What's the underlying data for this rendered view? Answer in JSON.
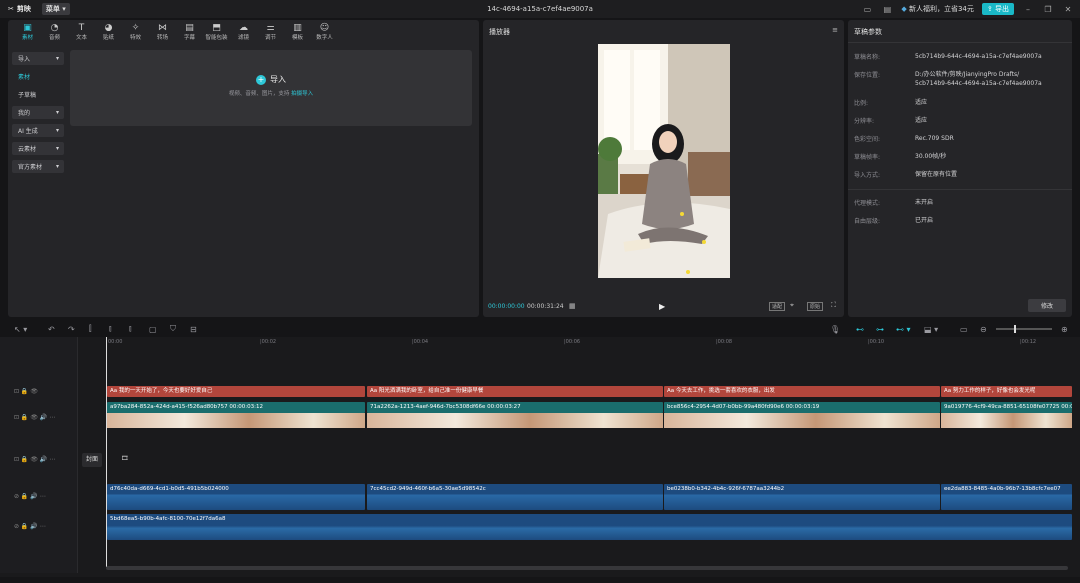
{
  "titlebar": {
    "app_name": "剪映",
    "menu_label": "菜单",
    "project_title": "14c-4694-a15a-c7ef4ae9007a",
    "promo": "新人福利，立省34元",
    "export_label": "导出"
  },
  "tabs": [
    {
      "label": "素材",
      "icon": "media-icon",
      "active": true
    },
    {
      "label": "音频",
      "icon": "audio-icon"
    },
    {
      "label": "文本",
      "icon": "text-icon"
    },
    {
      "label": "贴纸",
      "icon": "sticker-icon"
    },
    {
      "label": "特效",
      "icon": "effects-icon"
    },
    {
      "label": "转场",
      "icon": "transition-icon"
    },
    {
      "label": "字幕",
      "icon": "caption-icon"
    },
    {
      "label": "智能包装",
      "icon": "smart-pack-icon"
    },
    {
      "label": "滤镜",
      "icon": "filter-icon"
    },
    {
      "label": "调节",
      "icon": "adjust-icon"
    },
    {
      "label": "模板",
      "icon": "template-icon"
    },
    {
      "label": "数字人",
      "icon": "avatar-icon"
    }
  ],
  "sidebar": {
    "items": [
      {
        "label": "导入",
        "chevron": true,
        "box": true
      },
      {
        "label": "素材",
        "highlight": true
      },
      {
        "label": "子草稿"
      },
      {
        "label": "我的",
        "chevron": true,
        "box": true
      },
      {
        "label": "AI 生成",
        "chevron": true,
        "box": true
      },
      {
        "label": "云素材",
        "chevron": true,
        "box": true
      },
      {
        "label": "官方素材",
        "chevron": true,
        "box": true
      }
    ]
  },
  "import_area": {
    "button_label": "导入",
    "hint": "视频、音频、图片，支持",
    "hint_link": "拍摄导入"
  },
  "player": {
    "title": "播放器",
    "current_time": "00:00:00:00",
    "total_time": "00:00:31:24",
    "ratio_btn": "适配",
    "original_btn": "原始"
  },
  "params": {
    "title": "草稿参数",
    "rows": [
      {
        "key": "草稿名称:",
        "value": "5cb714b9-644c-4694-a15a-c7ef4ae9007a"
      },
      {
        "key": "保存位置:",
        "value": "D:/办公软件/剪映/JianyingPro Drafts/",
        "value2": "5cb714b9-644c-4694-a15a-c7ef4ae9007a"
      },
      {
        "key": "比例:",
        "value": "适应"
      },
      {
        "key": "分辨率:",
        "value": "适应"
      },
      {
        "key": "色彩空间:",
        "value": "Rec.709 SDR"
      },
      {
        "key": "草稿帧率:",
        "value": "30.00帧/秒"
      },
      {
        "key": "导入方式:",
        "value": "保留在原有位置"
      },
      {
        "key": "代理模式:",
        "value": "未开启"
      },
      {
        "key": "自由层级:",
        "value": "已开启"
      }
    ],
    "modify_label": "修改"
  },
  "ruler": {
    "ticks": [
      "00:00",
      "|00:02",
      "|00:04",
      "|00:06",
      "|00:08",
      "|00:10",
      "|00:12"
    ]
  },
  "timeline": {
    "cover_label": "封面",
    "subtitle_clips": [
      "我的一天开始了，今天也要好好爱自己",
      "阳光洒满我的卧室，给自己准一份健康早餐",
      "今天去工作，挑选一套喜欢的衣服，出发",
      "努力工作的样子，好像也会发光呢"
    ],
    "video_clips": [
      {
        "name": "a97ba284-852a-424d-a415-f526ad80b757",
        "dur": "00:00:03:12"
      },
      {
        "name": "71a2262a-1213-4aef-946d-7bc5308df66e",
        "dur": "00:00:03:27"
      },
      {
        "name": "bce856c4-2954-4d07-b0bb-99a480fd90e6",
        "dur": "00:00:03:19"
      },
      {
        "name": "9a019776-4cf9-49ca-8851-65108fe07725",
        "dur": "00:00:0"
      }
    ],
    "audio_clips": [
      "d76c40da-d669-4cd1-b0d5-491b5b024000",
      "7cc45cd2-949d-460f-b6a5-30ae5d98542c",
      "be0238b0-b342-4b4c-926f-6787aa3244b2",
      "ee2da883-8485-4a0b-96b7-13b8cfc7ee07"
    ],
    "music_clip": "5bd68ea5-b90b-4afc-8100-70e12f7da6a8"
  },
  "colors": {
    "accent": "#2ec8d8",
    "subtitle": "#b2463c",
    "video": "#1a6d6d",
    "audio": "#1d4b7f"
  }
}
